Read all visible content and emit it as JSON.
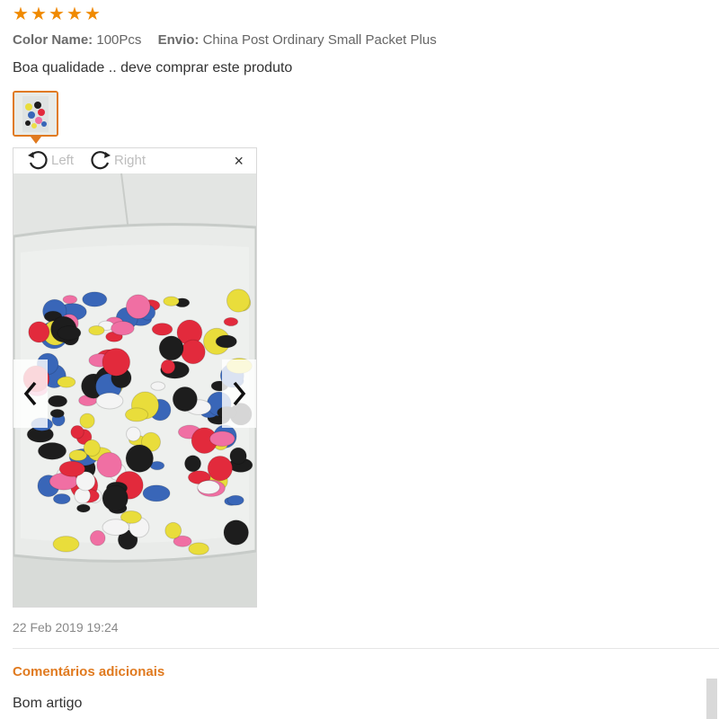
{
  "review": {
    "rating": 5,
    "rating_max": 5,
    "star_color": "#f08a00",
    "color_name_label": "Color Name:",
    "color_name_value": "100Pcs",
    "shipping_label": "Envio:",
    "shipping_value": "China Post Ordinary Small Packet Plus",
    "text": "Boa qualidade .. deve comprar este produto",
    "date": "22 Feb 2019 19:24"
  },
  "viewer": {
    "rotate_left_label": "Left",
    "rotate_right_label": "Right",
    "close_label": "×",
    "accent_color": "#e07a1f"
  },
  "additional": {
    "title": "Comentários adicionais",
    "text": "Bom artigo"
  }
}
